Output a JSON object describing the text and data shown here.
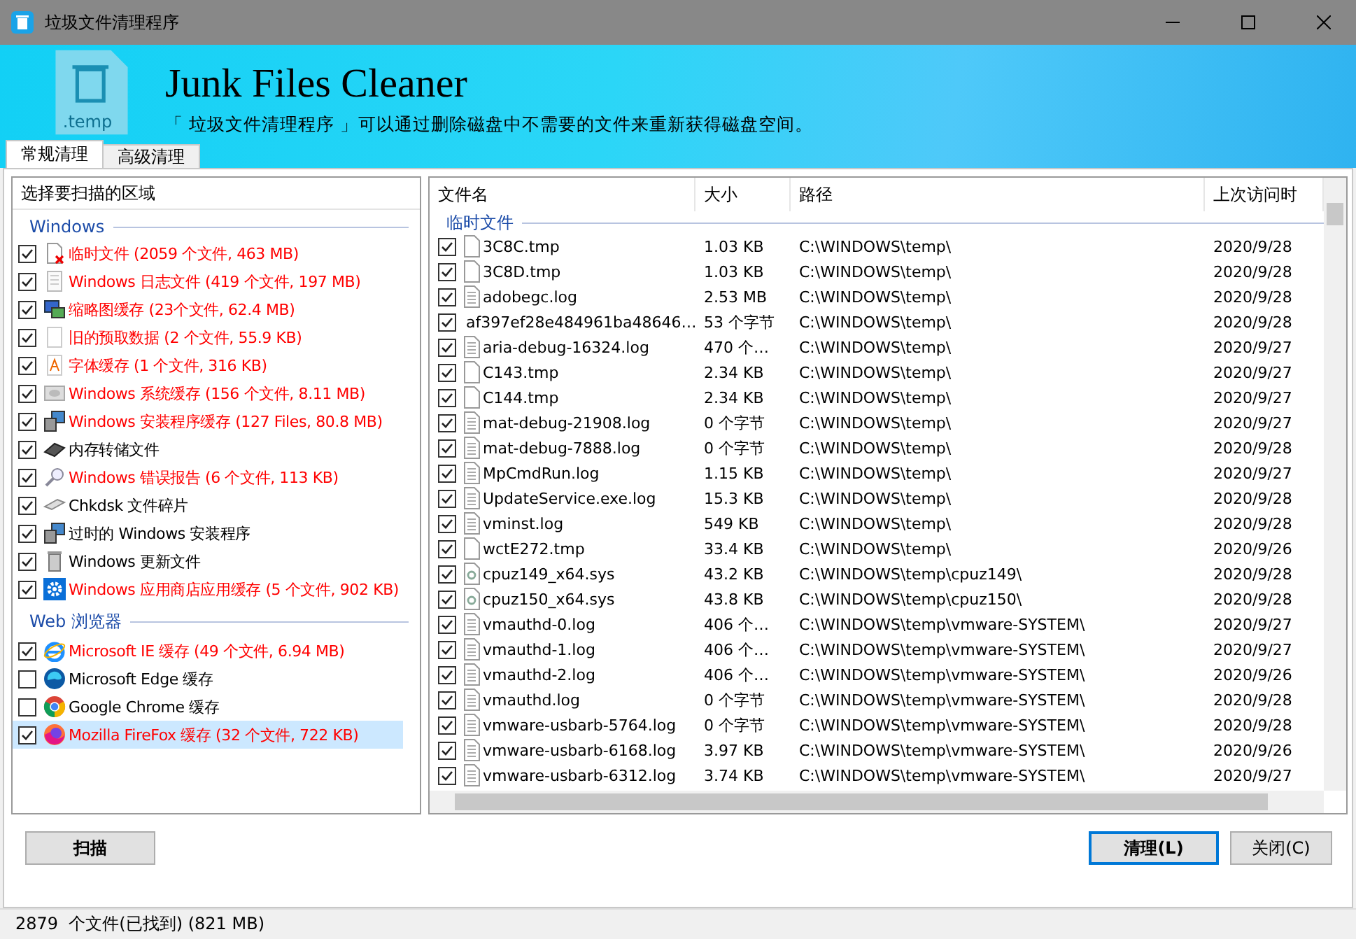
{
  "window": {
    "title": "垃圾文件清理程序"
  },
  "banner": {
    "title": "Junk Files Cleaner",
    "subtitle": "「 垃圾文件清理程序 」可以通过删除磁盘中不需要的文件来重新获得磁盘空间。",
    "icon_label": ".temp"
  },
  "tabs": [
    {
      "label": "常规清理",
      "selected": true
    },
    {
      "label": "高级清理",
      "selected": false
    }
  ],
  "areas": {
    "header": "选择要扫描的区域",
    "groups": [
      {
        "name": "Windows",
        "items": [
          {
            "label": "临时文件 (2059 个文件, 463 MB)",
            "checked": true,
            "found": true,
            "selected": false
          },
          {
            "label": "Windows 日志文件 (419 个文件, 197 MB)",
            "checked": true,
            "found": true,
            "selected": false
          },
          {
            "label": "缩略图缓存 (23个文件, 62.4 MB)",
            "checked": true,
            "found": true,
            "selected": false
          },
          {
            "label": "旧的预取数据 (2 个文件, 55.9 KB)",
            "checked": true,
            "found": true,
            "selected": false
          },
          {
            "label": "字体缓存 (1 个文件, 316 KB)",
            "checked": true,
            "found": true,
            "selected": false
          },
          {
            "label": "Windows 系统缓存 (156 个文件, 8.11 MB)",
            "checked": true,
            "found": true,
            "selected": false
          },
          {
            "label": "Windows 安装程序缓存 (127 Files, 80.8 MB)",
            "checked": true,
            "found": true,
            "selected": false
          },
          {
            "label": "内存转储文件",
            "checked": true,
            "found": false,
            "selected": false
          },
          {
            "label": "Windows 错误报告 (6 个文件, 113 KB)",
            "checked": true,
            "found": true,
            "selected": false
          },
          {
            "label": "Chkdsk 文件碎片",
            "checked": true,
            "found": false,
            "selected": false
          },
          {
            "label": "过时的 Windows 安装程序",
            "checked": true,
            "found": false,
            "selected": false
          },
          {
            "label": "Windows 更新文件",
            "checked": true,
            "found": false,
            "selected": false
          },
          {
            "label": "Windows 应用商店应用缓存 (5 个文件, 902 KB)",
            "checked": true,
            "found": true,
            "selected": false
          }
        ]
      },
      {
        "name": "Web 浏览器",
        "items": [
          {
            "label": "Microsoft IE 缓存 (49 个文件, 6.94 MB)",
            "checked": true,
            "found": true,
            "selected": false
          },
          {
            "label": "Microsoft Edge 缓存",
            "checked": false,
            "found": false,
            "selected": false
          },
          {
            "label": "Google Chrome 缓存",
            "checked": false,
            "found": false,
            "selected": false
          },
          {
            "label": "Mozilla FireFox 缓存 (32 个文件, 722 KB)",
            "checked": true,
            "found": true,
            "selected": true
          }
        ]
      }
    ]
  },
  "table": {
    "columns": [
      "文件名",
      "大小",
      "路径",
      "上次访问时"
    ],
    "group": "临时文件",
    "rows": [
      {
        "name": "3C8C.tmp",
        "size": "1.03 KB",
        "path": "C:\\WINDOWS\\temp\\",
        "date": "2020/9/28",
        "checked": true,
        "kind": "blank"
      },
      {
        "name": "3C8D.tmp",
        "size": "1.03 KB",
        "path": "C:\\WINDOWS\\temp\\",
        "date": "2020/9/28",
        "checked": true,
        "kind": "blank"
      },
      {
        "name": "adobegc.log",
        "size": "2.53 MB",
        "path": "C:\\WINDOWS\\temp\\",
        "date": "2020/9/28",
        "checked": true,
        "kind": "text"
      },
      {
        "name": "af397ef28e484961ba48646…",
        "size": "53 个字节",
        "path": "C:\\WINDOWS\\temp\\",
        "date": "2020/9/28",
        "checked": true,
        "kind": "blank"
      },
      {
        "name": "aria-debug-16324.log",
        "size": "470 个…",
        "path": "C:\\WINDOWS\\temp\\",
        "date": "2020/9/27",
        "checked": true,
        "kind": "text"
      },
      {
        "name": "C143.tmp",
        "size": "2.34 KB",
        "path": "C:\\WINDOWS\\temp\\",
        "date": "2020/9/27",
        "checked": true,
        "kind": "blank"
      },
      {
        "name": "C144.tmp",
        "size": "2.34 KB",
        "path": "C:\\WINDOWS\\temp\\",
        "date": "2020/9/27",
        "checked": true,
        "kind": "blank"
      },
      {
        "name": "mat-debug-21908.log",
        "size": "0 个字节",
        "path": "C:\\WINDOWS\\temp\\",
        "date": "2020/9/27",
        "checked": true,
        "kind": "text"
      },
      {
        "name": "mat-debug-7888.log",
        "size": "0 个字节",
        "path": "C:\\WINDOWS\\temp\\",
        "date": "2020/9/28",
        "checked": true,
        "kind": "text"
      },
      {
        "name": "MpCmdRun.log",
        "size": "1.15 KB",
        "path": "C:\\WINDOWS\\temp\\",
        "date": "2020/9/27",
        "checked": true,
        "kind": "text"
      },
      {
        "name": "UpdateService.exe.log",
        "size": "15.3 KB",
        "path": "C:\\WINDOWS\\temp\\",
        "date": "2020/9/28",
        "checked": true,
        "kind": "text"
      },
      {
        "name": "vminst.log",
        "size": "549 KB",
        "path": "C:\\WINDOWS\\temp\\",
        "date": "2020/9/28",
        "checked": true,
        "kind": "text"
      },
      {
        "name": "wctE272.tmp",
        "size": "33.4 KB",
        "path": "C:\\WINDOWS\\temp\\",
        "date": "2020/9/26",
        "checked": true,
        "kind": "blank"
      },
      {
        "name": "cpuz149_x64.sys",
        "size": "43.2 KB",
        "path": "C:\\WINDOWS\\temp\\cpuz149\\",
        "date": "2020/9/28",
        "checked": true,
        "kind": "sys"
      },
      {
        "name": "cpuz150_x64.sys",
        "size": "43.8 KB",
        "path": "C:\\WINDOWS\\temp\\cpuz150\\",
        "date": "2020/9/28",
        "checked": true,
        "kind": "sys"
      },
      {
        "name": "vmauthd-0.log",
        "size": "406 个…",
        "path": "C:\\WINDOWS\\temp\\vmware-SYSTEM\\",
        "date": "2020/9/27",
        "checked": true,
        "kind": "text"
      },
      {
        "name": "vmauthd-1.log",
        "size": "406 个…",
        "path": "C:\\WINDOWS\\temp\\vmware-SYSTEM\\",
        "date": "2020/9/27",
        "checked": true,
        "kind": "text"
      },
      {
        "name": "vmauthd-2.log",
        "size": "406 个…",
        "path": "C:\\WINDOWS\\temp\\vmware-SYSTEM\\",
        "date": "2020/9/26",
        "checked": true,
        "kind": "text"
      },
      {
        "name": "vmauthd.log",
        "size": "0 个字节",
        "path": "C:\\WINDOWS\\temp\\vmware-SYSTEM\\",
        "date": "2020/9/28",
        "checked": true,
        "kind": "text"
      },
      {
        "name": "vmware-usbarb-5764.log",
        "size": "0 个字节",
        "path": "C:\\WINDOWS\\temp\\vmware-SYSTEM\\",
        "date": "2020/9/28",
        "checked": true,
        "kind": "text"
      },
      {
        "name": "vmware-usbarb-6168.log",
        "size": "3.97 KB",
        "path": "C:\\WINDOWS\\temp\\vmware-SYSTEM\\",
        "date": "2020/9/26",
        "checked": true,
        "kind": "text"
      },
      {
        "name": "vmware-usbarb-6312.log",
        "size": "3.74 KB",
        "path": "C:\\WINDOWS\\temp\\vmware-SYSTEM\\",
        "date": "2020/9/27",
        "checked": true,
        "kind": "text"
      }
    ]
  },
  "buttons": {
    "scan": "扫描",
    "clean": "清理(L)",
    "close": "关闭(C)"
  },
  "status_bar": "2879  个文件(已找到) (821 MB)"
}
